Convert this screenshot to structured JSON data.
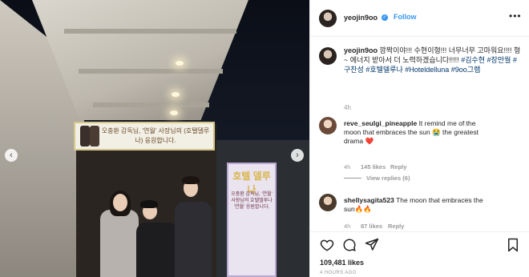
{
  "post": {
    "username": "yeojin9oo",
    "follow_label": "Follow",
    "caption_user": "yeojin9oo",
    "caption_text": "깜짝이야!!! 수현이형!!! 너무너무 고마워요!!!! 형~ 에너지 받아서 더 노력하겠습니다!!!!!",
    "caption_tags": "#김수현 #장만월 #구찬성 #호텔델루나 #Hoteldelluna #9oo그램",
    "caption_time": "4h",
    "likes_text": "109,481 likes",
    "posted_time": "4 HOURS AGO"
  },
  "comments": [
    {
      "username": "reve_seulgi_pineapple",
      "text": "It remind me of the moon that embraces the sun 😭 the greatest drama ❤️",
      "time": "4h",
      "likes": "145 likes",
      "reply": "Reply",
      "view_replies": "View replies (6)"
    },
    {
      "username": "shellysagita523",
      "text": "The moon that embraces the sun🔥🔥",
      "time": "4h",
      "likes": "87 likes",
      "reply": "Reply"
    }
  ],
  "photo": {
    "banner_text": "오충환 감독님, '연월' 사장님의 (호텔델루나) 응원합니다.",
    "sign_title": "호텔 델루나",
    "sign_text": "오충환 감독님, '연월' 사장님의 호텔델루나 '연월' 응원합니다."
  },
  "colors": {
    "link": "#3897f0",
    "hashtag": "#003569",
    "muted": "#999999",
    "text": "#262626"
  },
  "icons": [
    "chevron-left-icon",
    "chevron-right-icon",
    "verified-icon",
    "more-icon",
    "heart-icon",
    "comment-icon",
    "share-icon",
    "bookmark-icon",
    "close-icon"
  ]
}
